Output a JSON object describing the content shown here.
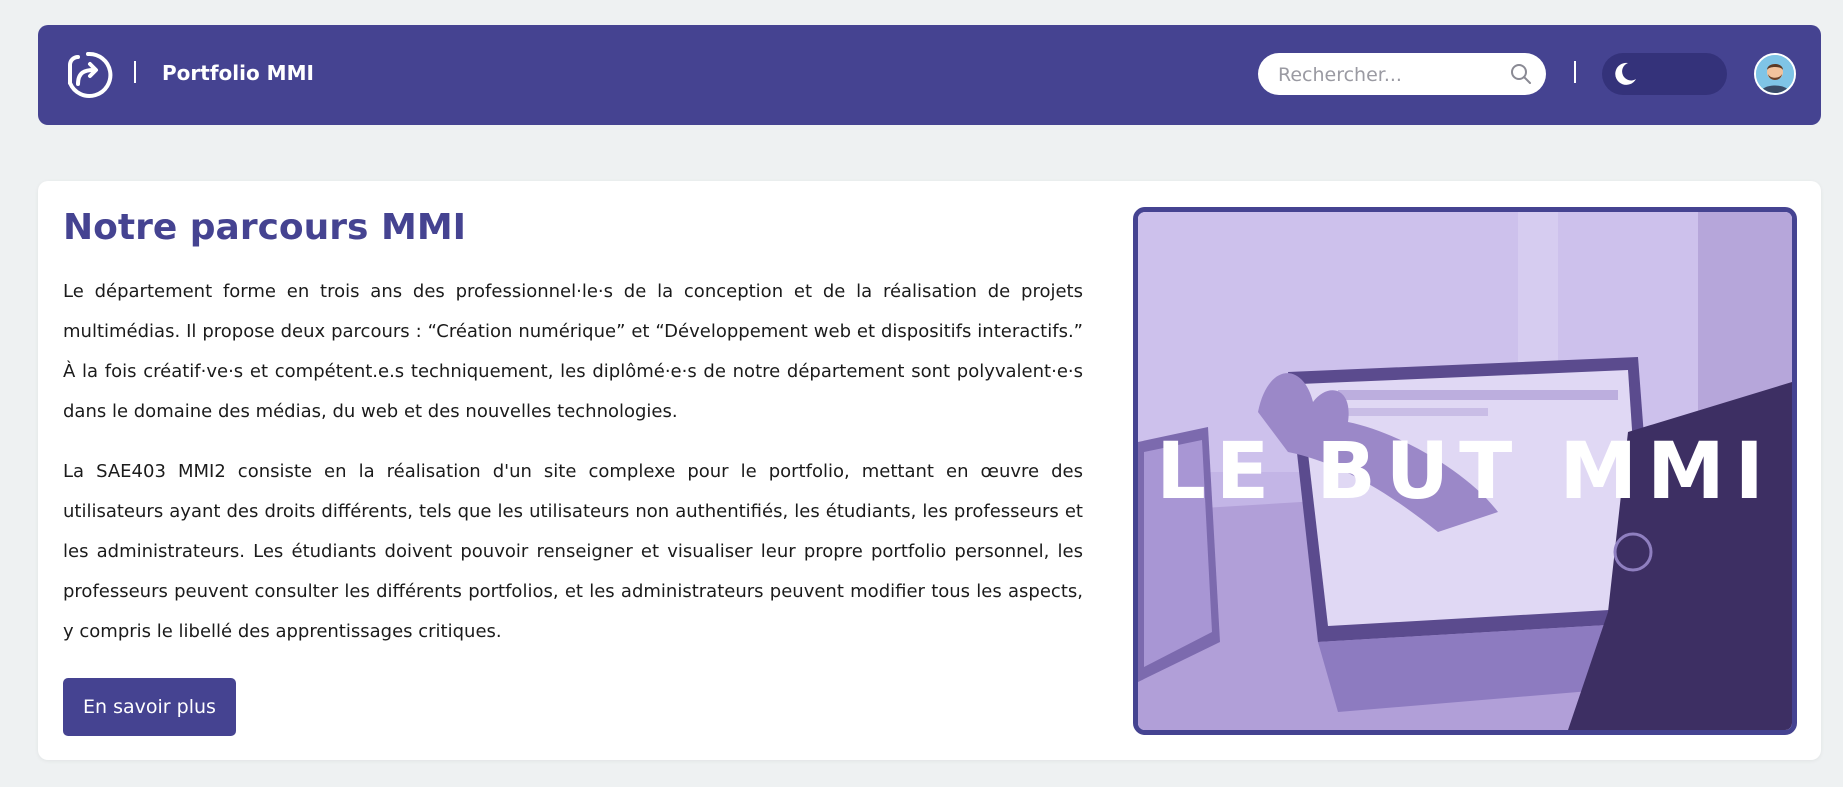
{
  "colors": {
    "primary": "#454391",
    "page_background": "#eef1f2",
    "card_background": "#ffffff",
    "title": "#454391"
  },
  "navbar": {
    "logo_icon": "portfolio-logo-icon",
    "separator_1": "|",
    "brand": "Portfolio MMI",
    "search": {
      "placeholder": "Rechercher...",
      "value": "",
      "icon": "search-icon"
    },
    "separator_2": "|",
    "theme_toggle": {
      "icon": "moon-icon",
      "state": "dark-mode-off"
    },
    "avatar_icon": "user-avatar"
  },
  "main": {
    "title": "Notre parcours MMI",
    "paragraph_1": "Le département forme en trois ans des professionnel·le·s de la conception et de la réalisation de projets multimédias. Il propose deux parcours : “Création numérique” et “Développement web et dispositifs interactifs.” À la fois créatif·ve·s et compétent.e.s techniquement, les diplômé·e·s de notre département sont polyvalent·e·s dans le domaine des médias, du web et des nouvelles technologies.",
    "paragraph_2": "La SAE403 MMI2 consiste en la réalisation d'un site complexe pour le portfolio, mettant en œuvre des utilisateurs ayant des droits différents, tels que les utilisateurs non authentifiés, les étudiants, les professeurs et les administrateurs. Les étudiants doivent pouvoir renseigner et visualiser leur propre portfolio personnel, les professeurs peuvent consulter les différents portfolios, et les administrateurs peuvent modifier tous les aspects, y compris le libellé des apprentissages critiques.",
    "button_label": "En savoir plus",
    "hero_image": {
      "caption": "LE BUT MMI",
      "tint": "#b9a8de"
    }
  }
}
